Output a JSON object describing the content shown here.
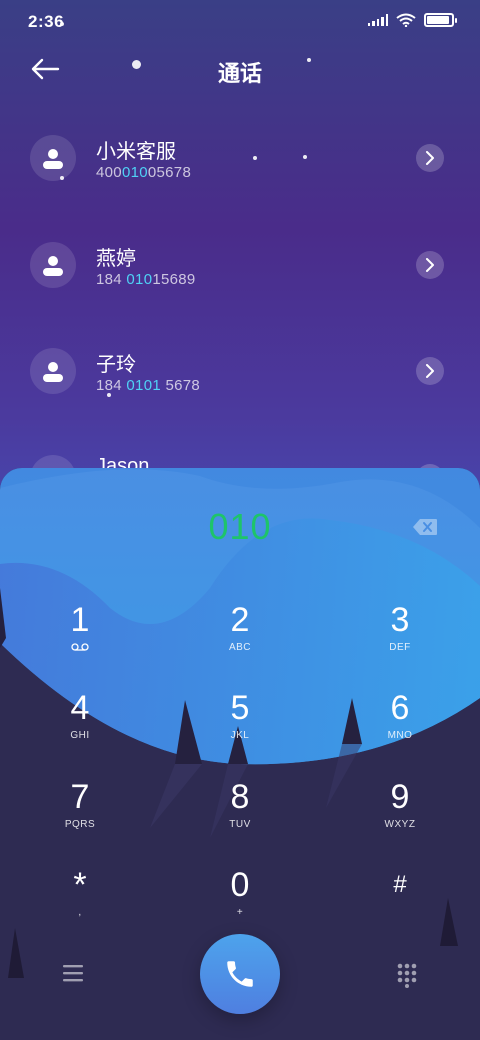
{
  "status_bar": {
    "time": "2:36",
    "battery_level": 0.9
  },
  "header": {
    "title": "通话"
  },
  "contacts": [
    {
      "name": "小米客服",
      "number_pre": "400",
      "number_hl": "010",
      "number_post": "05678"
    },
    {
      "name": "燕婷",
      "number_pre": "184 ",
      "number_hl": "010",
      "number_post": "15689"
    },
    {
      "name": "子玲",
      "number_pre": "184 ",
      "number_hl": "0101",
      "number_post": " 5678"
    },
    {
      "name": "Jason"
    }
  ],
  "dialer": {
    "input_value": "010",
    "keys": [
      {
        "digit": "1",
        "letters": ""
      },
      {
        "digit": "2",
        "letters": "ABC"
      },
      {
        "digit": "3",
        "letters": "DEF"
      },
      {
        "digit": "4",
        "letters": "GHI"
      },
      {
        "digit": "5",
        "letters": "JKL"
      },
      {
        "digit": "6",
        "letters": "MNO"
      },
      {
        "digit": "7",
        "letters": "PQRS"
      },
      {
        "digit": "8",
        "letters": "TUV"
      },
      {
        "digit": "9",
        "letters": "WXYZ"
      },
      {
        "digit": "*",
        "letters": ","
      },
      {
        "digit": "0",
        "letters": "+"
      },
      {
        "digit": "#",
        "letters": ""
      }
    ]
  },
  "colors": {
    "accent": "#4fd2f5",
    "dial_text": "#1ec46a",
    "call_button": "#4f8fe6"
  }
}
